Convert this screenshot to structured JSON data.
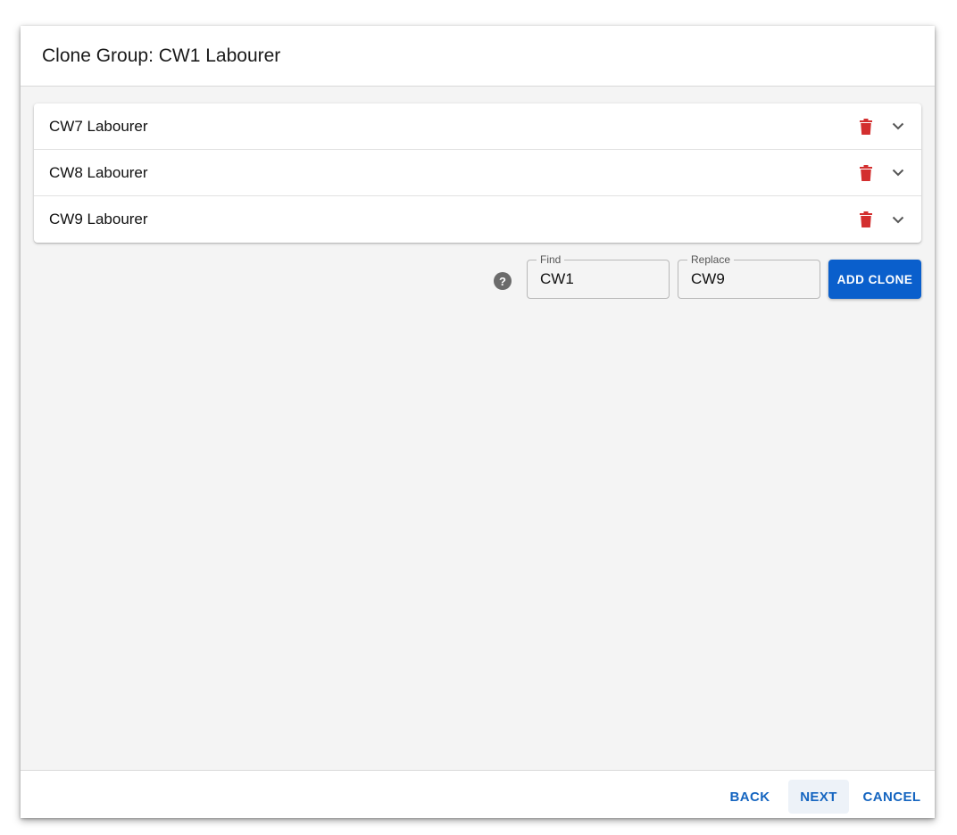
{
  "dialog": {
    "title": "Clone Group: CW1 Labourer"
  },
  "clones": [
    {
      "label": "CW7 Labourer"
    },
    {
      "label": "CW8 Labourer"
    },
    {
      "label": "CW9 Labourer"
    }
  ],
  "find_replace": {
    "help_glyph": "?",
    "find_label": "Find",
    "find_value": "CW1",
    "replace_label": "Replace",
    "replace_value": "CW9",
    "add_clone_label": "ADD CLONE"
  },
  "footer": {
    "back_label": "BACK",
    "next_label": "NEXT",
    "cancel_label": "CANCEL"
  },
  "colors": {
    "primary": "#0a5fcc",
    "danger": "#d32f2f",
    "link": "#1565c0"
  },
  "icons": {
    "delete": "trash-icon",
    "expand": "chevron-down-icon",
    "help": "help-circle-icon"
  }
}
